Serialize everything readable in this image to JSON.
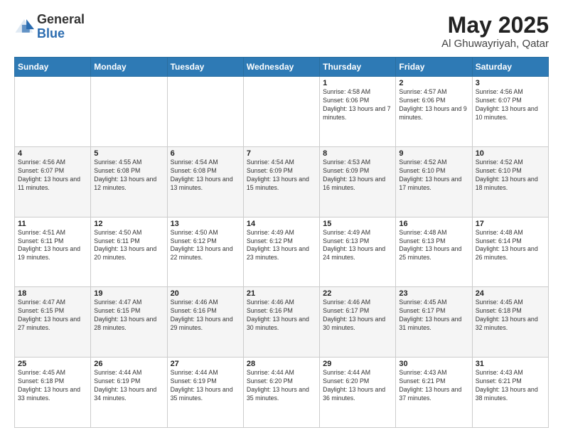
{
  "header": {
    "logo_general": "General",
    "logo_blue": "Blue",
    "title_month": "May 2025",
    "title_location": "Al Ghuwayriyah, Qatar"
  },
  "calendar": {
    "days_of_week": [
      "Sunday",
      "Monday",
      "Tuesday",
      "Wednesday",
      "Thursday",
      "Friday",
      "Saturday"
    ],
    "weeks": [
      {
        "row": 1,
        "days": [
          {
            "num": "",
            "info": ""
          },
          {
            "num": "",
            "info": ""
          },
          {
            "num": "",
            "info": ""
          },
          {
            "num": "",
            "info": ""
          },
          {
            "num": "1",
            "info": "Sunrise: 4:58 AM\nSunset: 6:06 PM\nDaylight: 13 hours\nand 7 minutes."
          },
          {
            "num": "2",
            "info": "Sunrise: 4:57 AM\nSunset: 6:06 PM\nDaylight: 13 hours\nand 9 minutes."
          },
          {
            "num": "3",
            "info": "Sunrise: 4:56 AM\nSunset: 6:07 PM\nDaylight: 13 hours\nand 10 minutes."
          }
        ]
      },
      {
        "row": 2,
        "days": [
          {
            "num": "4",
            "info": "Sunrise: 4:56 AM\nSunset: 6:07 PM\nDaylight: 13 hours\nand 11 minutes."
          },
          {
            "num": "5",
            "info": "Sunrise: 4:55 AM\nSunset: 6:08 PM\nDaylight: 13 hours\nand 12 minutes."
          },
          {
            "num": "6",
            "info": "Sunrise: 4:54 AM\nSunset: 6:08 PM\nDaylight: 13 hours\nand 13 minutes."
          },
          {
            "num": "7",
            "info": "Sunrise: 4:54 AM\nSunset: 6:09 PM\nDaylight: 13 hours\nand 15 minutes."
          },
          {
            "num": "8",
            "info": "Sunrise: 4:53 AM\nSunset: 6:09 PM\nDaylight: 13 hours\nand 16 minutes."
          },
          {
            "num": "9",
            "info": "Sunrise: 4:52 AM\nSunset: 6:10 PM\nDaylight: 13 hours\nand 17 minutes."
          },
          {
            "num": "10",
            "info": "Sunrise: 4:52 AM\nSunset: 6:10 PM\nDaylight: 13 hours\nand 18 minutes."
          }
        ]
      },
      {
        "row": 3,
        "days": [
          {
            "num": "11",
            "info": "Sunrise: 4:51 AM\nSunset: 6:11 PM\nDaylight: 13 hours\nand 19 minutes."
          },
          {
            "num": "12",
            "info": "Sunrise: 4:50 AM\nSunset: 6:11 PM\nDaylight: 13 hours\nand 20 minutes."
          },
          {
            "num": "13",
            "info": "Sunrise: 4:50 AM\nSunset: 6:12 PM\nDaylight: 13 hours\nand 22 minutes."
          },
          {
            "num": "14",
            "info": "Sunrise: 4:49 AM\nSunset: 6:12 PM\nDaylight: 13 hours\nand 23 minutes."
          },
          {
            "num": "15",
            "info": "Sunrise: 4:49 AM\nSunset: 6:13 PM\nDaylight: 13 hours\nand 24 minutes."
          },
          {
            "num": "16",
            "info": "Sunrise: 4:48 AM\nSunset: 6:13 PM\nDaylight: 13 hours\nand 25 minutes."
          },
          {
            "num": "17",
            "info": "Sunrise: 4:48 AM\nSunset: 6:14 PM\nDaylight: 13 hours\nand 26 minutes."
          }
        ]
      },
      {
        "row": 4,
        "days": [
          {
            "num": "18",
            "info": "Sunrise: 4:47 AM\nSunset: 6:15 PM\nDaylight: 13 hours\nand 27 minutes."
          },
          {
            "num": "19",
            "info": "Sunrise: 4:47 AM\nSunset: 6:15 PM\nDaylight: 13 hours\nand 28 minutes."
          },
          {
            "num": "20",
            "info": "Sunrise: 4:46 AM\nSunset: 6:16 PM\nDaylight: 13 hours\nand 29 minutes."
          },
          {
            "num": "21",
            "info": "Sunrise: 4:46 AM\nSunset: 6:16 PM\nDaylight: 13 hours\nand 30 minutes."
          },
          {
            "num": "22",
            "info": "Sunrise: 4:46 AM\nSunset: 6:17 PM\nDaylight: 13 hours\nand 30 minutes."
          },
          {
            "num": "23",
            "info": "Sunrise: 4:45 AM\nSunset: 6:17 PM\nDaylight: 13 hours\nand 31 minutes."
          },
          {
            "num": "24",
            "info": "Sunrise: 4:45 AM\nSunset: 6:18 PM\nDaylight: 13 hours\nand 32 minutes."
          }
        ]
      },
      {
        "row": 5,
        "days": [
          {
            "num": "25",
            "info": "Sunrise: 4:45 AM\nSunset: 6:18 PM\nDaylight: 13 hours\nand 33 minutes."
          },
          {
            "num": "26",
            "info": "Sunrise: 4:44 AM\nSunset: 6:19 PM\nDaylight: 13 hours\nand 34 minutes."
          },
          {
            "num": "27",
            "info": "Sunrise: 4:44 AM\nSunset: 6:19 PM\nDaylight: 13 hours\nand 35 minutes."
          },
          {
            "num": "28",
            "info": "Sunrise: 4:44 AM\nSunset: 6:20 PM\nDaylight: 13 hours\nand 35 minutes."
          },
          {
            "num": "29",
            "info": "Sunrise: 4:44 AM\nSunset: 6:20 PM\nDaylight: 13 hours\nand 36 minutes."
          },
          {
            "num": "30",
            "info": "Sunrise: 4:43 AM\nSunset: 6:21 PM\nDaylight: 13 hours\nand 37 minutes."
          },
          {
            "num": "31",
            "info": "Sunrise: 4:43 AM\nSunset: 6:21 PM\nDaylight: 13 hours\nand 38 minutes."
          }
        ]
      }
    ]
  }
}
